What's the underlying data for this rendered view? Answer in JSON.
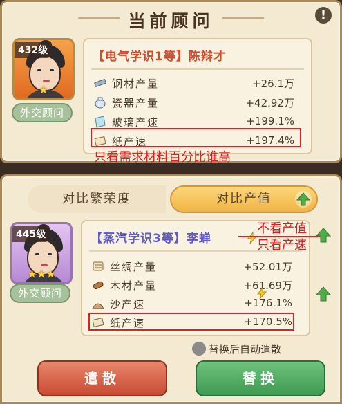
{
  "header": {
    "title": "当前顾问"
  },
  "current_advisor": {
    "level": "432级",
    "stars": "★",
    "role": "外交顾问",
    "name": "【电气学识1等】陈辩才",
    "stats": [
      {
        "icon": "steel-icon",
        "name": "钢材产量",
        "value": "+26.1万"
      },
      {
        "icon": "porcelain-icon",
        "name": "瓷器产量",
        "value": "+42.92万"
      },
      {
        "icon": "glass-icon",
        "name": "玻璃产速",
        "value": "+199.1%"
      },
      {
        "icon": "paper-icon",
        "name": "纸产速",
        "value": "+197.4%"
      }
    ],
    "annotation": "只看需求材料百分比谁高"
  },
  "compare_tabs": {
    "left": "对比繁荣度",
    "right": "对比产值"
  },
  "candidate_advisor": {
    "level": "445级",
    "stars": "★★★",
    "role": "外交顾问",
    "name": "【蒸汽学识3等】李蝉",
    "stats": [
      {
        "icon": "silk-icon",
        "name": "丝绸产量",
        "value": "+52.01万"
      },
      {
        "icon": "wood-icon",
        "name": "木材产量",
        "value": "+61.69万"
      },
      {
        "icon": "sand-icon",
        "name": "沙产速",
        "value": "+176.1%"
      },
      {
        "icon": "paper-icon",
        "name": "纸产速",
        "value": "+170.5%"
      }
    ],
    "annotation_1": "不看产值",
    "annotation_2": "只看产速"
  },
  "auto_dismiss_label": "替换后自动遣散",
  "buttons": {
    "dismiss": "遣散",
    "replace": "替换"
  },
  "colors": {
    "accent_red": "#e01f1f",
    "dismiss_btn": "#c94b32",
    "replace_btn": "#3f9a52"
  }
}
